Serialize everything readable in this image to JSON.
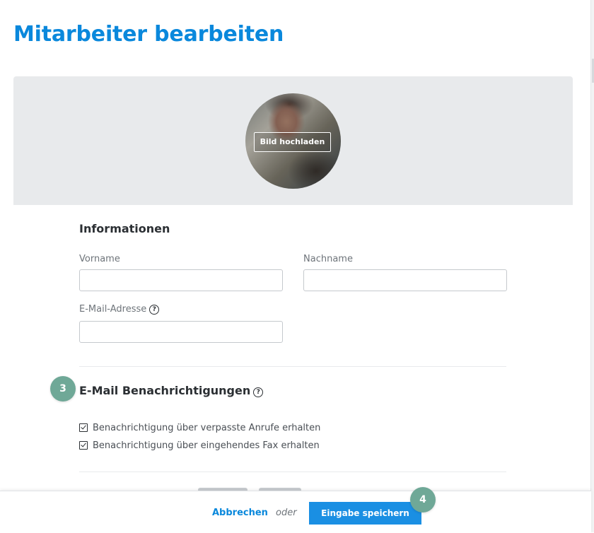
{
  "page": {
    "title": "Mitarbeiter bearbeiten"
  },
  "avatar": {
    "upload_label": "Bild hochladen"
  },
  "info": {
    "heading": "Informationen",
    "first_name": {
      "label": "Vorname",
      "value": "",
      "placeholder": ""
    },
    "last_name": {
      "label": "Nachname",
      "value": "",
      "placeholder": ""
    },
    "email": {
      "label": "E-Mail-Adresse",
      "value": "",
      "placeholder": ""
    }
  },
  "notifications": {
    "step": "3",
    "heading": "E-Mail Benachrichtigungen",
    "options": [
      {
        "label": "Benachrichtigung über verpasste Anrufe erhalten",
        "checked": true
      },
      {
        "label": "Benachrichtigung über eingehendes Fax erhalten",
        "checked": true
      }
    ]
  },
  "footer": {
    "cancel_label": "Abbrechen",
    "or_label": "oder",
    "save_label": "Eingabe speichern",
    "step": "4"
  },
  "icons": {
    "help": "?"
  },
  "colors": {
    "accent": "#0a88dc",
    "button": "#1a8fe3",
    "step_badge": "#6fa897",
    "panel": "#e8eaec"
  }
}
